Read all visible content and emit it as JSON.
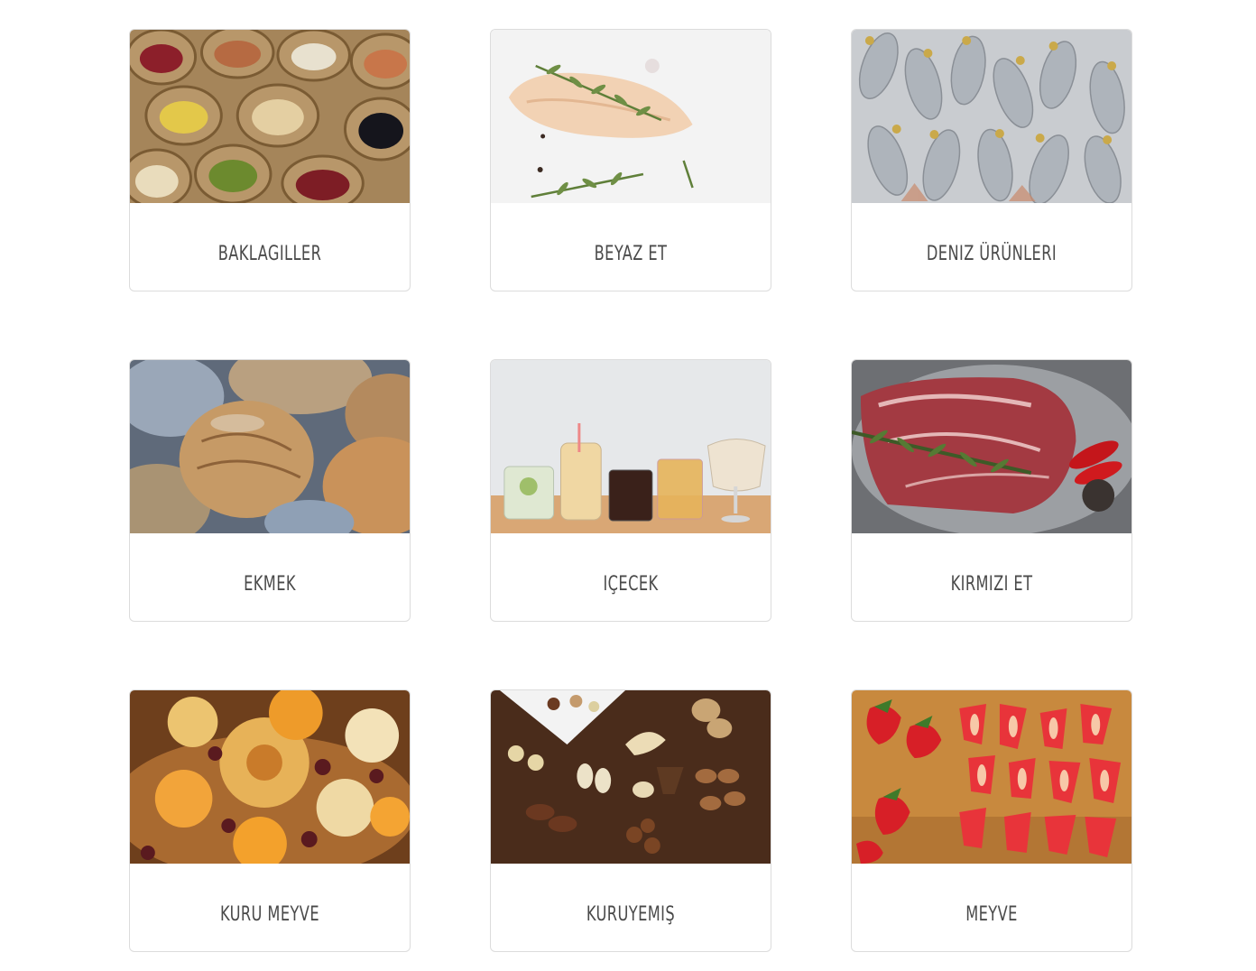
{
  "categories": [
    {
      "label": "BAKLAGILLER",
      "icon": "legumes-photo"
    },
    {
      "label": "BEYAZ ET",
      "icon": "chicken-photo"
    },
    {
      "label": "DENIZ ÜRÜNLERI",
      "icon": "fish-photo"
    },
    {
      "label": "EKMEK",
      "icon": "bread-photo"
    },
    {
      "label": "IÇECEK",
      "icon": "drinks-photo"
    },
    {
      "label": "KIRMIZI ET",
      "icon": "red-meat-photo"
    },
    {
      "label": "KURU MEYVE",
      "icon": "dried-fruit-photo"
    },
    {
      "label": "KURUYEMIŞ",
      "icon": "nuts-photo"
    },
    {
      "label": "MEYVE",
      "icon": "fruit-photo"
    }
  ]
}
